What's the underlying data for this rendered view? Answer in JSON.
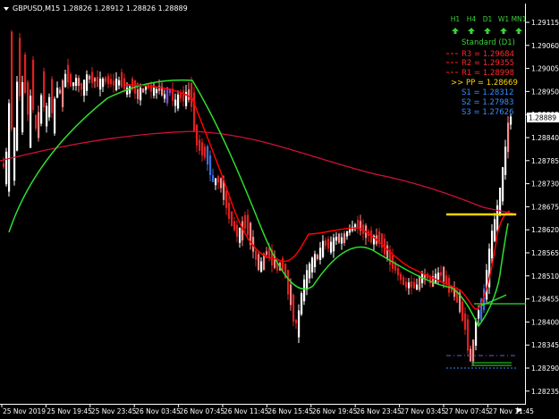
{
  "header": {
    "symbol_info": "GBPUSD,M15  1.28826 1.28912 1.28826 1.28889"
  },
  "colors": {
    "background": "#000000",
    "axis": "#ffffff",
    "candle_up": "#ffffff",
    "candle_down": "#e02020",
    "bar_neutral": "#ff8a8a",
    "bar_blue": "#3a6fe0",
    "bar_purple": "#7f4bd8",
    "ma_fast": "#ff0000",
    "ma_slow": "#d0103a",
    "ma_green": "#2ee02e",
    "pivot": "#ffd400",
    "resistance": "#ff1a1a",
    "support": "#2d8cff",
    "panel_green": "#3bd13b"
  },
  "timeframe_panel": {
    "labels": [
      "H1",
      "H4",
      "D1",
      "W1",
      "MN1"
    ],
    "arrows": [
      "up",
      "up",
      "up",
      "up",
      "up"
    ],
    "standard_label": "Standard (D1)"
  },
  "pivots": {
    "r3": "R3 = 1.29684",
    "r2": "R2 = 1.29355",
    "r1": "R1 = 1.28998",
    "pp": ">> PP = 1.28669",
    "s1": "S1 = 1.28312",
    "s2": "S2 = 1.27983",
    "s3": "S3 = 1.27626"
  },
  "price_axis": {
    "ticks": [
      "1.29115",
      "1.29060",
      "1.29005",
      "1.28950",
      "1.28895",
      "1.28840",
      "1.28785",
      "1.28730",
      "1.28675",
      "1.28620",
      "1.28565",
      "1.28510",
      "1.28455",
      "1.28400",
      "1.28345",
      "1.28290",
      "1.28235"
    ],
    "current_price": "1.28889"
  },
  "time_axis": {
    "ticks": [
      "25 Nov 2019",
      "25 Nov 19:45",
      "25 Nov 23:45",
      "26 Nov 03:45",
      "26 Nov 07:45",
      "26 Nov 11:45",
      "26 Nov 15:45",
      "26 Nov 19:45",
      "26 Nov 23:45",
      "27 Nov 03:45",
      "27 Nov 07:45",
      "27 Nov 11:45"
    ]
  },
  "chart_data": {
    "type": "candlestick",
    "symbol": "GBPUSD",
    "timeframe": "M15",
    "ylim": [
      1.2821,
      1.2914
    ],
    "price_levels": {
      "pivot_pp": 1.28669,
      "current": 1.28889
    },
    "indicators": [
      "moving average (red)",
      "moving average (dark red)",
      "moving average (green)"
    ]
  }
}
